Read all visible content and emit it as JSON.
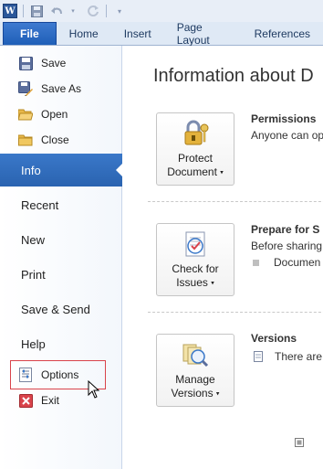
{
  "app": {
    "logo_letter": "W"
  },
  "tabs": [
    {
      "label": "File"
    },
    {
      "label": "Home"
    },
    {
      "label": "Insert"
    },
    {
      "label": "Page Layout"
    },
    {
      "label": "References"
    }
  ],
  "backstage": {
    "commands": [
      {
        "label": "Save",
        "icon": "save-icon"
      },
      {
        "label": "Save As",
        "icon": "save-as-icon"
      },
      {
        "label": "Open",
        "icon": "open-folder-icon"
      },
      {
        "label": "Close",
        "icon": "close-folder-icon"
      }
    ],
    "nav": [
      {
        "label": "Info",
        "active": true
      },
      {
        "label": "Recent"
      },
      {
        "label": "New"
      },
      {
        "label": "Print"
      },
      {
        "label": "Save & Send"
      },
      {
        "label": "Help"
      }
    ],
    "bottom_commands": [
      {
        "label": "Options",
        "icon": "options-icon",
        "highlighted": true
      },
      {
        "label": "Exit",
        "icon": "exit-icon"
      }
    ]
  },
  "info": {
    "title": "Information about D",
    "sections": [
      {
        "button_line1": "Protect",
        "button_line2": "Document",
        "icon": "lock-keys-icon",
        "heading": "Permissions",
        "text": "Anyone can op"
      },
      {
        "button_line1": "Check for",
        "button_line2": "Issues",
        "icon": "checklist-icon",
        "heading": "Prepare for S",
        "text": "Before sharing",
        "bullet_text": "Documen"
      },
      {
        "button_line1": "Manage",
        "button_line2": "Versions",
        "icon": "versions-icon",
        "heading": "Versions",
        "text": "There are"
      }
    ]
  },
  "colors": {
    "accent": "#2a63b0",
    "highlight_border": "#d9434b"
  }
}
